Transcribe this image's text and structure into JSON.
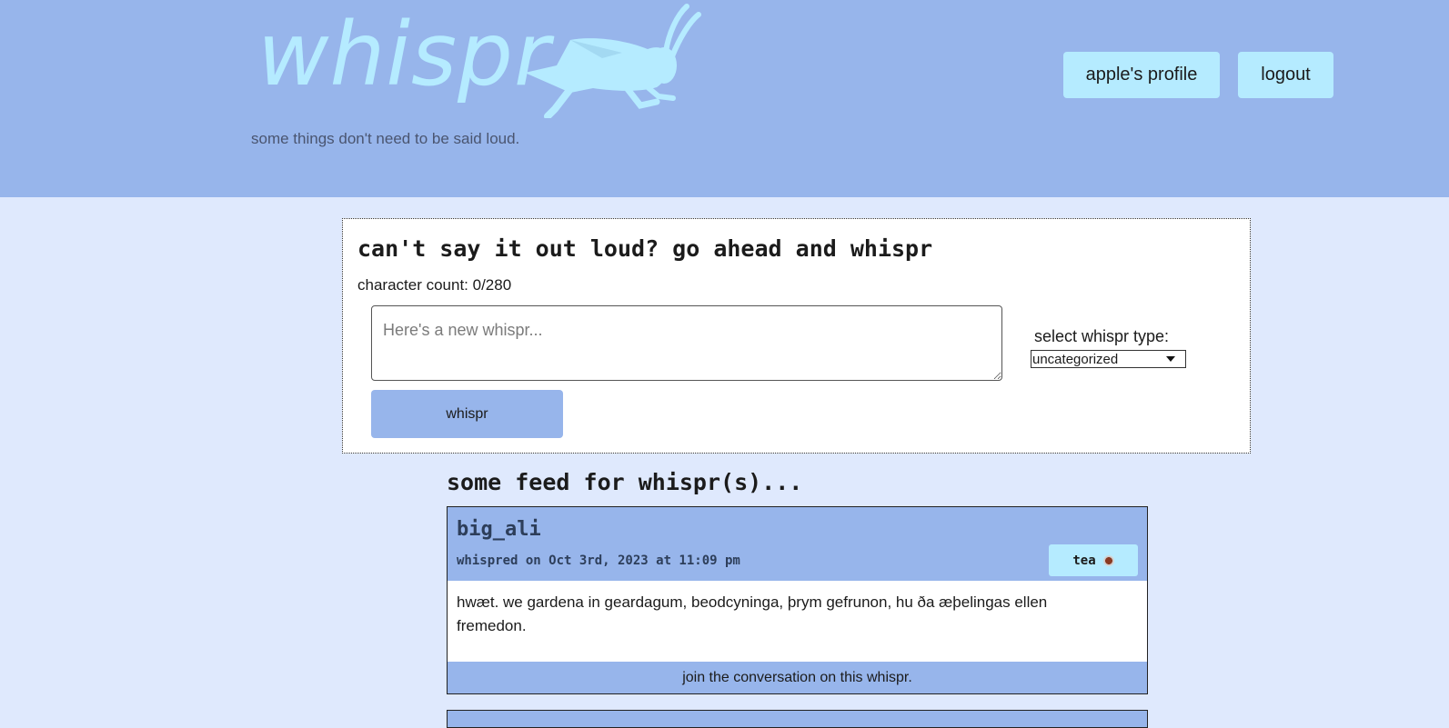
{
  "header": {
    "logo_text": "whispr",
    "logo_icon": "grasshopper-icon",
    "tagline": "some things don't need to be said loud.",
    "profile_label": "apple's profile",
    "logout_label": "logout"
  },
  "compose": {
    "title": "can't say it out loud? go ahead and whispr",
    "char_count_label": "character count: 0/280",
    "input_placeholder": "Here's a new whispr...",
    "input_value": "",
    "type_label": "select whispr type:",
    "type_selected": "uncategorized",
    "submit_label": "whispr"
  },
  "feed": {
    "title": "some feed for whispr(s)...",
    "posts": [
      {
        "author": "big_ali",
        "date": "whispred on Oct 3rd, 2023 at 11:09 pm",
        "tag": "tea",
        "tag_icon": "tea-cup-icon",
        "body": "hwæt. we gardena in geardagum, beodcyninga, þrym gefrunon, hu ða æþelingas ellen fremedon.",
        "footer_link": "join the conversation on this whispr."
      }
    ]
  },
  "colors": {
    "header_bg": "#97b5eb",
    "page_bg": "#dfe9fd",
    "accent_light": "#b5ebff",
    "button_bg": "#97b5eb"
  }
}
